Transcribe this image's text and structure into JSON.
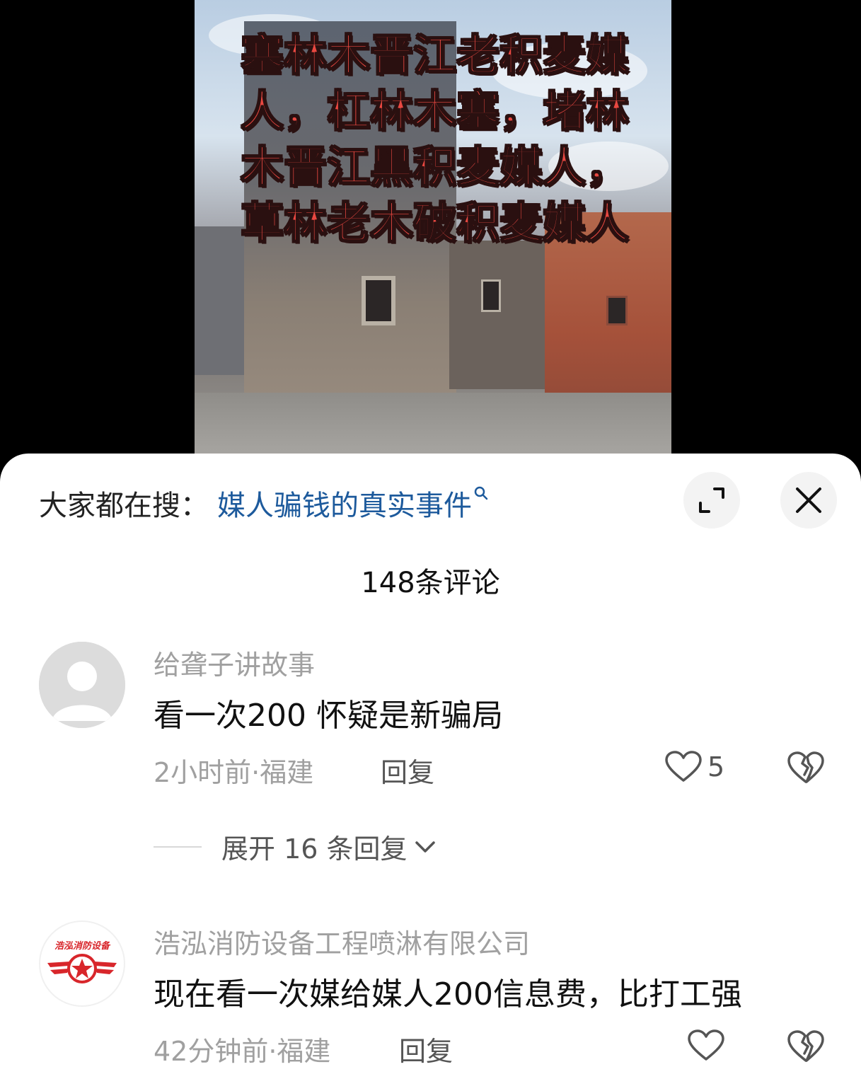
{
  "video": {
    "overlay_lines": [
      "塞林木晋江老积麦媒",
      "人，杠林木塞，堵林",
      "木晋江黑积麦媒人，",
      "草林老木破积麦媒人"
    ]
  },
  "search_bar": {
    "prefix": "大家都在搜：",
    "link": "媒人骗钱的真实事件"
  },
  "comments_header": {
    "count_label": "148条评论"
  },
  "comments": [
    {
      "username": "给聋子讲故事",
      "text": "看一次200 怀疑是新骗局",
      "meta": "2小时前·福建",
      "reply_label": "回复",
      "likes": "5",
      "expand_label": "展开 16 条回复"
    },
    {
      "username": "浩泓消防设备工程喷淋有限公司",
      "avatar_text": "浩泓消防设备",
      "text": "现在看一次媒给媒人200信息费，比打工强",
      "meta": "42分钟前·福建",
      "reply_label": "回复"
    }
  ],
  "colors": {
    "link": "#1d5a9c",
    "overlay_text": "#e94841",
    "logo_red": "#d8262b"
  }
}
